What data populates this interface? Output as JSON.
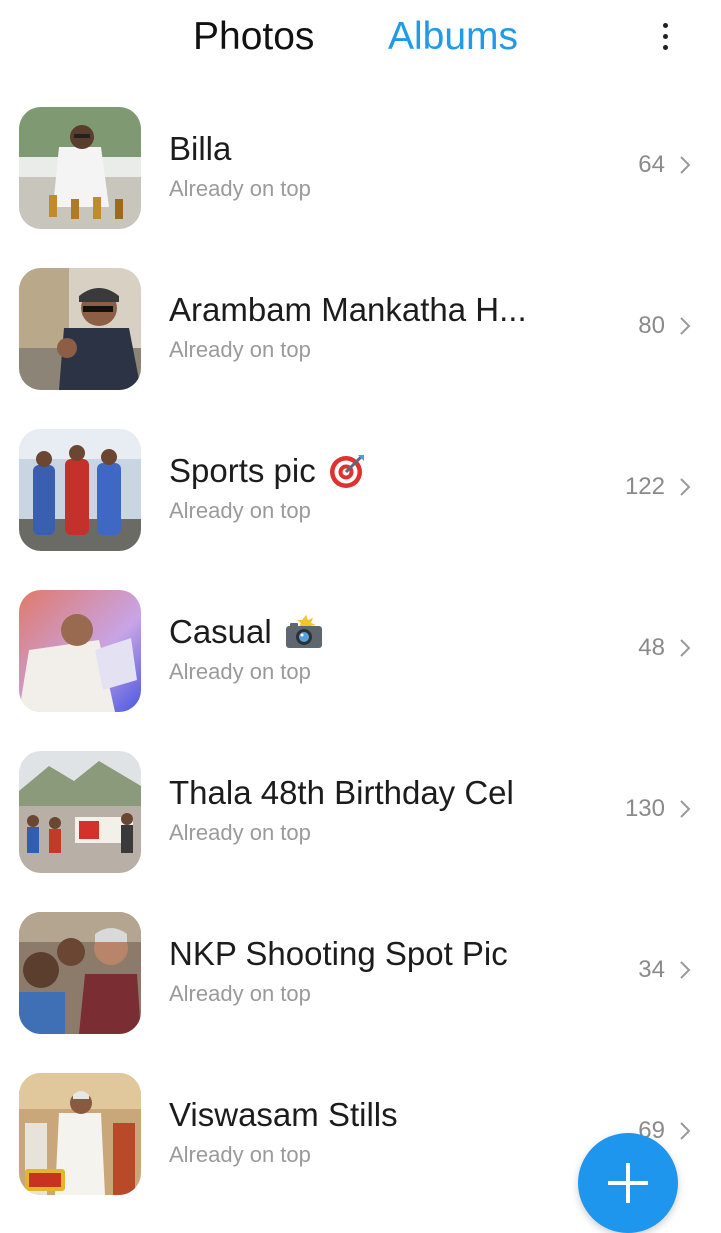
{
  "header": {
    "tab_photos": "Photos",
    "tab_albums": "Albums",
    "more_icon": "more-vertical-icon",
    "active_tab": "Albums",
    "active_color": "#1e9be9"
  },
  "albums": [
    {
      "title": "Billa",
      "subtitle": "Already on top",
      "count": "64",
      "emoji": ""
    },
    {
      "title": "Arambam Mankatha H...",
      "subtitle": "Already on top",
      "count": "80",
      "emoji": ""
    },
    {
      "title": "Sports pic",
      "subtitle": "Already on top",
      "count": "122",
      "emoji": "target-icon"
    },
    {
      "title": "Casual",
      "subtitle": "Already on top",
      "count": "48",
      "emoji": "camera-flash-icon"
    },
    {
      "title": "Thala 48th Birthday Cel",
      "subtitle": "Already on top",
      "count": "130",
      "emoji": ""
    },
    {
      "title": "NKP Shooting Spot Pic",
      "subtitle": "Already on top",
      "count": "34",
      "emoji": ""
    },
    {
      "title": "Viswasam Stills",
      "subtitle": "Already on top",
      "count": "69",
      "emoji": ""
    }
  ],
  "fab": {
    "icon": "plus-icon",
    "color": "#1e96ee"
  }
}
